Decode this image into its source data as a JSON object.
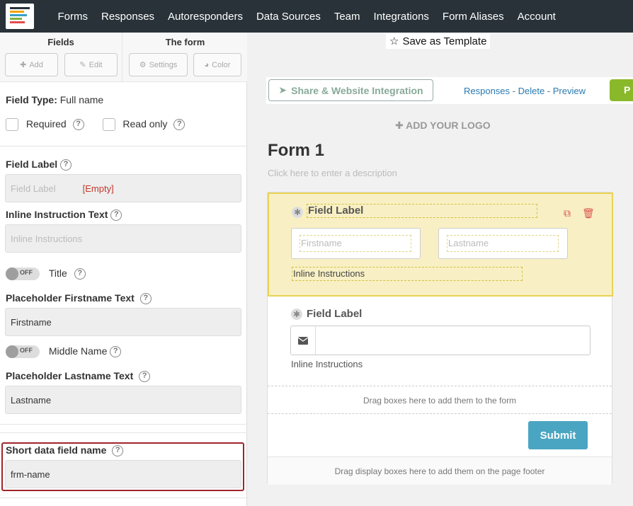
{
  "nav": {
    "logo": "app-logo",
    "links": [
      "Forms",
      "Responses",
      "Autoresponders",
      "Data Sources",
      "Team",
      "Integrations",
      "Form Aliases",
      "Account"
    ]
  },
  "left_panel": {
    "fields_title": "Fields",
    "form_title": "The form",
    "buttons": {
      "add": "Add",
      "edit": "Edit",
      "settings": "Settings",
      "color": "Color"
    },
    "field_type_label": "Field Type:",
    "field_type_value": "Full name",
    "required_label": "Required",
    "read_only_label": "Read only",
    "field_label_title": "Field Label",
    "field_label_placeholder": "Field Label",
    "field_label_empty": "[Empty]",
    "inline_instruction_title": "Inline Instruction Text",
    "inline_instruction_placeholder": "Inline Instructions",
    "title_toggle_state": "OFF",
    "title_toggle_label": "Title",
    "placeholder_firstname_title": "Placeholder Firstname Text",
    "placeholder_firstname_value": "Firstname",
    "middle_toggle_state": "OFF",
    "middle_toggle_label": "Middle Name",
    "placeholder_lastname_title": "Placeholder Lastname Text",
    "placeholder_lastname_value": "Lastname",
    "short_name_title": "Short data field name",
    "short_name_value": "frm-name",
    "help_glyph": "?"
  },
  "editor": {
    "save_template": "Save as Template",
    "share_button": "Share & Website Integration",
    "link_responses": "Responses",
    "link_delete": "Delete",
    "link_preview": "Preview",
    "link_sep": " - ",
    "publish_stub": "P",
    "add_logo": "ADD YOUR LOGO",
    "form_title": "Form 1",
    "form_description": "Click here to enter a description",
    "field1": {
      "label": "Field Label",
      "first_placeholder": "Firstname",
      "last_placeholder": "Lastname",
      "inline": "Inline Instructions"
    },
    "field2": {
      "label": "Field Label",
      "inline": "Inline Instructions"
    },
    "drag_boxes": "Drag boxes here to add them to the form",
    "submit": "Submit",
    "drag_footer": "Drag display boxes here to add them on the page footer"
  },
  "colors": {
    "nav_bg": "#283238",
    "selected_field_bg": "#f8f0c4",
    "selected_field_border": "#e8d356",
    "submit_bg": "#4aa5c2",
    "publish_bg": "#8ab82b",
    "highlight_border": "#a0252a",
    "link": "#2a7ab0"
  }
}
